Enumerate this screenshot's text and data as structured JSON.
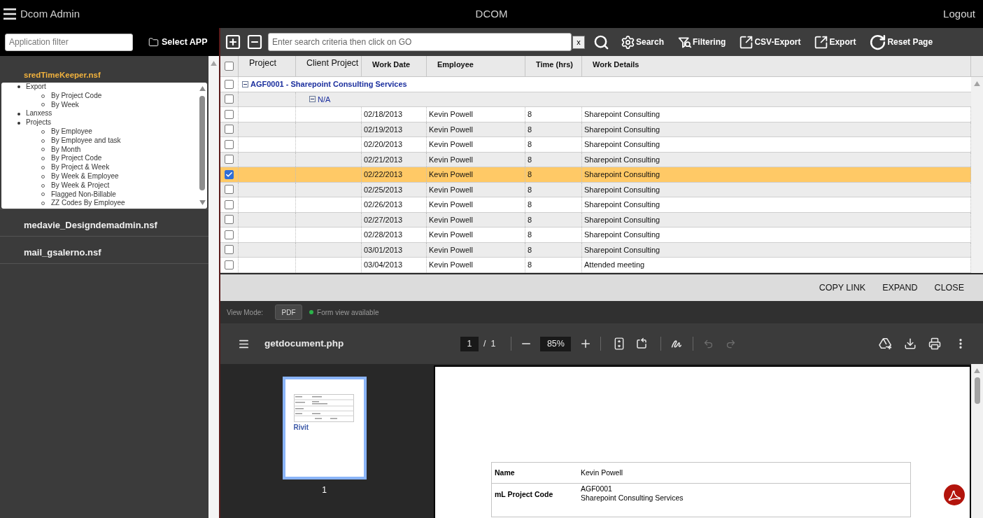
{
  "header": {
    "app_name": "Dcom Admin",
    "title": "DCOM",
    "logout": "Logout"
  },
  "sidebar": {
    "filter": {
      "placeholder": "Application filter"
    },
    "select_app": "Select APP",
    "apps": [
      {
        "name": "sredTimeKeeper.nsf",
        "expanded": true,
        "views": [
          {
            "label": "Export",
            "children": [
              {
                "label": "By Project Code"
              },
              {
                "label": "By Week"
              }
            ]
          },
          {
            "label": "Lanxess"
          },
          {
            "label": "Projects",
            "children": [
              {
                "label": "By Employee"
              },
              {
                "label": "By Employee and task"
              },
              {
                "label": "By Month"
              },
              {
                "label": "By Project Code"
              },
              {
                "label": "By Project & Week"
              },
              {
                "label": "By Week & Employee"
              },
              {
                "label": "By Week & Project"
              },
              {
                "label": "Flagged Non-Billable"
              },
              {
                "label": "ZZ Codes By Employee"
              }
            ]
          }
        ]
      },
      {
        "name": "medavie_Designdemadmin.nsf",
        "expanded": false
      },
      {
        "name": "mail_gsalerno.nsf",
        "expanded": false
      }
    ]
  },
  "toolbar": {
    "search": {
      "placeholder": "Enter search criteria then click on GO"
    },
    "clear": "x",
    "actions": [
      {
        "kind": "search",
        "label": "Search"
      },
      {
        "kind": "filter",
        "label": "Filtering"
      },
      {
        "kind": "csv-export",
        "label": "CSV-Export"
      },
      {
        "kind": "export",
        "label": "Export"
      },
      {
        "kind": "reset",
        "label": "Reset Page"
      }
    ]
  },
  "table": {
    "select_all": {
      "checked": false
    },
    "columns": [
      {
        "label": "Project",
        "kind": "category"
      },
      {
        "label": "Client Project",
        "kind": "category"
      },
      {
        "label": "Work Date",
        "kind": "data"
      },
      {
        "label": "Employee",
        "kind": "data"
      },
      {
        "label": "Time (hrs)",
        "kind": "data"
      },
      {
        "label": "Work Details",
        "kind": "data"
      }
    ],
    "groups": [
      {
        "label": "AGF0001 - Sharepoint Consulting Services",
        "checked": false,
        "expanded": true,
        "children": [
          {
            "label": "N/A",
            "checked": false,
            "expanded": true,
            "rows": [
              {
                "checked": false,
                "selected": false,
                "work_date": "02/18/2013",
                "employee": "Kevin Powell",
                "time": "8",
                "work_details": "Sharepoint Consulting"
              },
              {
                "checked": false,
                "selected": false,
                "work_date": "02/19/2013",
                "employee": "Kevin Powell",
                "time": "8",
                "work_details": "Sharepoint Consulting"
              },
              {
                "checked": false,
                "selected": false,
                "work_date": "02/20/2013",
                "employee": "Kevin Powell",
                "time": "8",
                "work_details": "Sharepoint Consulting"
              },
              {
                "checked": false,
                "selected": false,
                "work_date": "02/21/2013",
                "employee": "Kevin Powell",
                "time": "8",
                "work_details": "Sharepoint Consulting"
              },
              {
                "checked": true,
                "selected": true,
                "work_date": "02/22/2013",
                "employee": "Kevin Powell",
                "time": "8",
                "work_details": "Sharepoint Consulting"
              },
              {
                "checked": false,
                "selected": false,
                "work_date": "02/25/2013",
                "employee": "Kevin Powell",
                "time": "8",
                "work_details": "Sharepoint Consulting"
              },
              {
                "checked": false,
                "selected": false,
                "work_date": "02/26/2013",
                "employee": "Kevin Powell",
                "time": "8",
                "work_details": "Sharepoint Consulting"
              },
              {
                "checked": false,
                "selected": false,
                "work_date": "02/27/2013",
                "employee": "Kevin Powell",
                "time": "8",
                "work_details": "Sharepoint Consulting"
              },
              {
                "checked": false,
                "selected": false,
                "work_date": "02/28/2013",
                "employee": "Kevin Powell",
                "time": "8",
                "work_details": "Sharepoint Consulting"
              },
              {
                "checked": false,
                "selected": false,
                "work_date": "03/01/2013",
                "employee": "Kevin Powell",
                "time": "8",
                "work_details": "Sharepoint Consulting"
              },
              {
                "checked": false,
                "selected": false,
                "work_date": "03/04/2013",
                "employee": "Kevin Powell",
                "time": "8",
                "work_details": "Attended meeting"
              }
            ]
          }
        ]
      }
    ]
  },
  "preview": {
    "actions": [
      "COPY LINK",
      "EXPAND",
      "CLOSE"
    ],
    "view_mode": {
      "label": "View Mode:",
      "button": "PDF",
      "status": "Form view available",
      "available": true
    }
  },
  "pdf_viewer": {
    "file_name": "getdocument.php",
    "page": "1",
    "separator": "/",
    "page_count": "1",
    "zoom": "85%",
    "undo": {
      "disabled": true
    },
    "redo": {
      "disabled": true
    },
    "thumbnails": [
      {
        "label": "1",
        "selected": true,
        "logo": "Rivit"
      }
    ],
    "document": {
      "fields": [
        {
          "label": "Name",
          "lines": [
            "Kevin Powell"
          ]
        },
        {
          "label": "mL Project Code",
          "lines": [
            "AGF0001",
            "Sharepoint Consulting Services"
          ]
        }
      ]
    }
  }
}
